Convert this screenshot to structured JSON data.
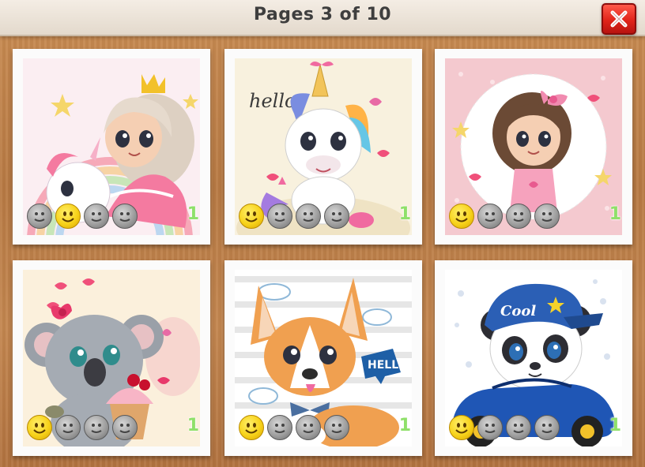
{
  "header": {
    "title": "Pages 3 of 10",
    "close_icon": "close-x-icon"
  },
  "colors": {
    "done_face": "#f7d21a",
    "todo_face": "#9a9a9a",
    "level_number": "#8fe06a",
    "close_button": "#e0241a"
  },
  "cards": [
    {
      "subject": "princess-with-unicorn",
      "progress": [
        "gray",
        "done",
        "gray",
        "gray"
      ],
      "level": "1"
    },
    {
      "subject": "unicorn",
      "progress": [
        "done",
        "gray",
        "gray",
        "gray"
      ],
      "level": "1"
    },
    {
      "subject": "girl-with-bow",
      "progress": [
        "done",
        "gray",
        "gray",
        "gray"
      ],
      "level": "1"
    },
    {
      "subject": "koala-with-cupcake",
      "progress": [
        "done",
        "gray",
        "gray",
        "gray"
      ],
      "level": "1"
    },
    {
      "subject": "corgi-puppy",
      "art_text": "HELLO",
      "progress": [
        "done",
        "gray",
        "gray",
        "gray"
      ],
      "level": "1"
    },
    {
      "subject": "panda-in-car",
      "art_text": "Cool",
      "progress": [
        "done",
        "gray",
        "gray",
        "gray"
      ],
      "level": "1"
    }
  ],
  "art_labels": {
    "unicorn_hello": "hello"
  }
}
